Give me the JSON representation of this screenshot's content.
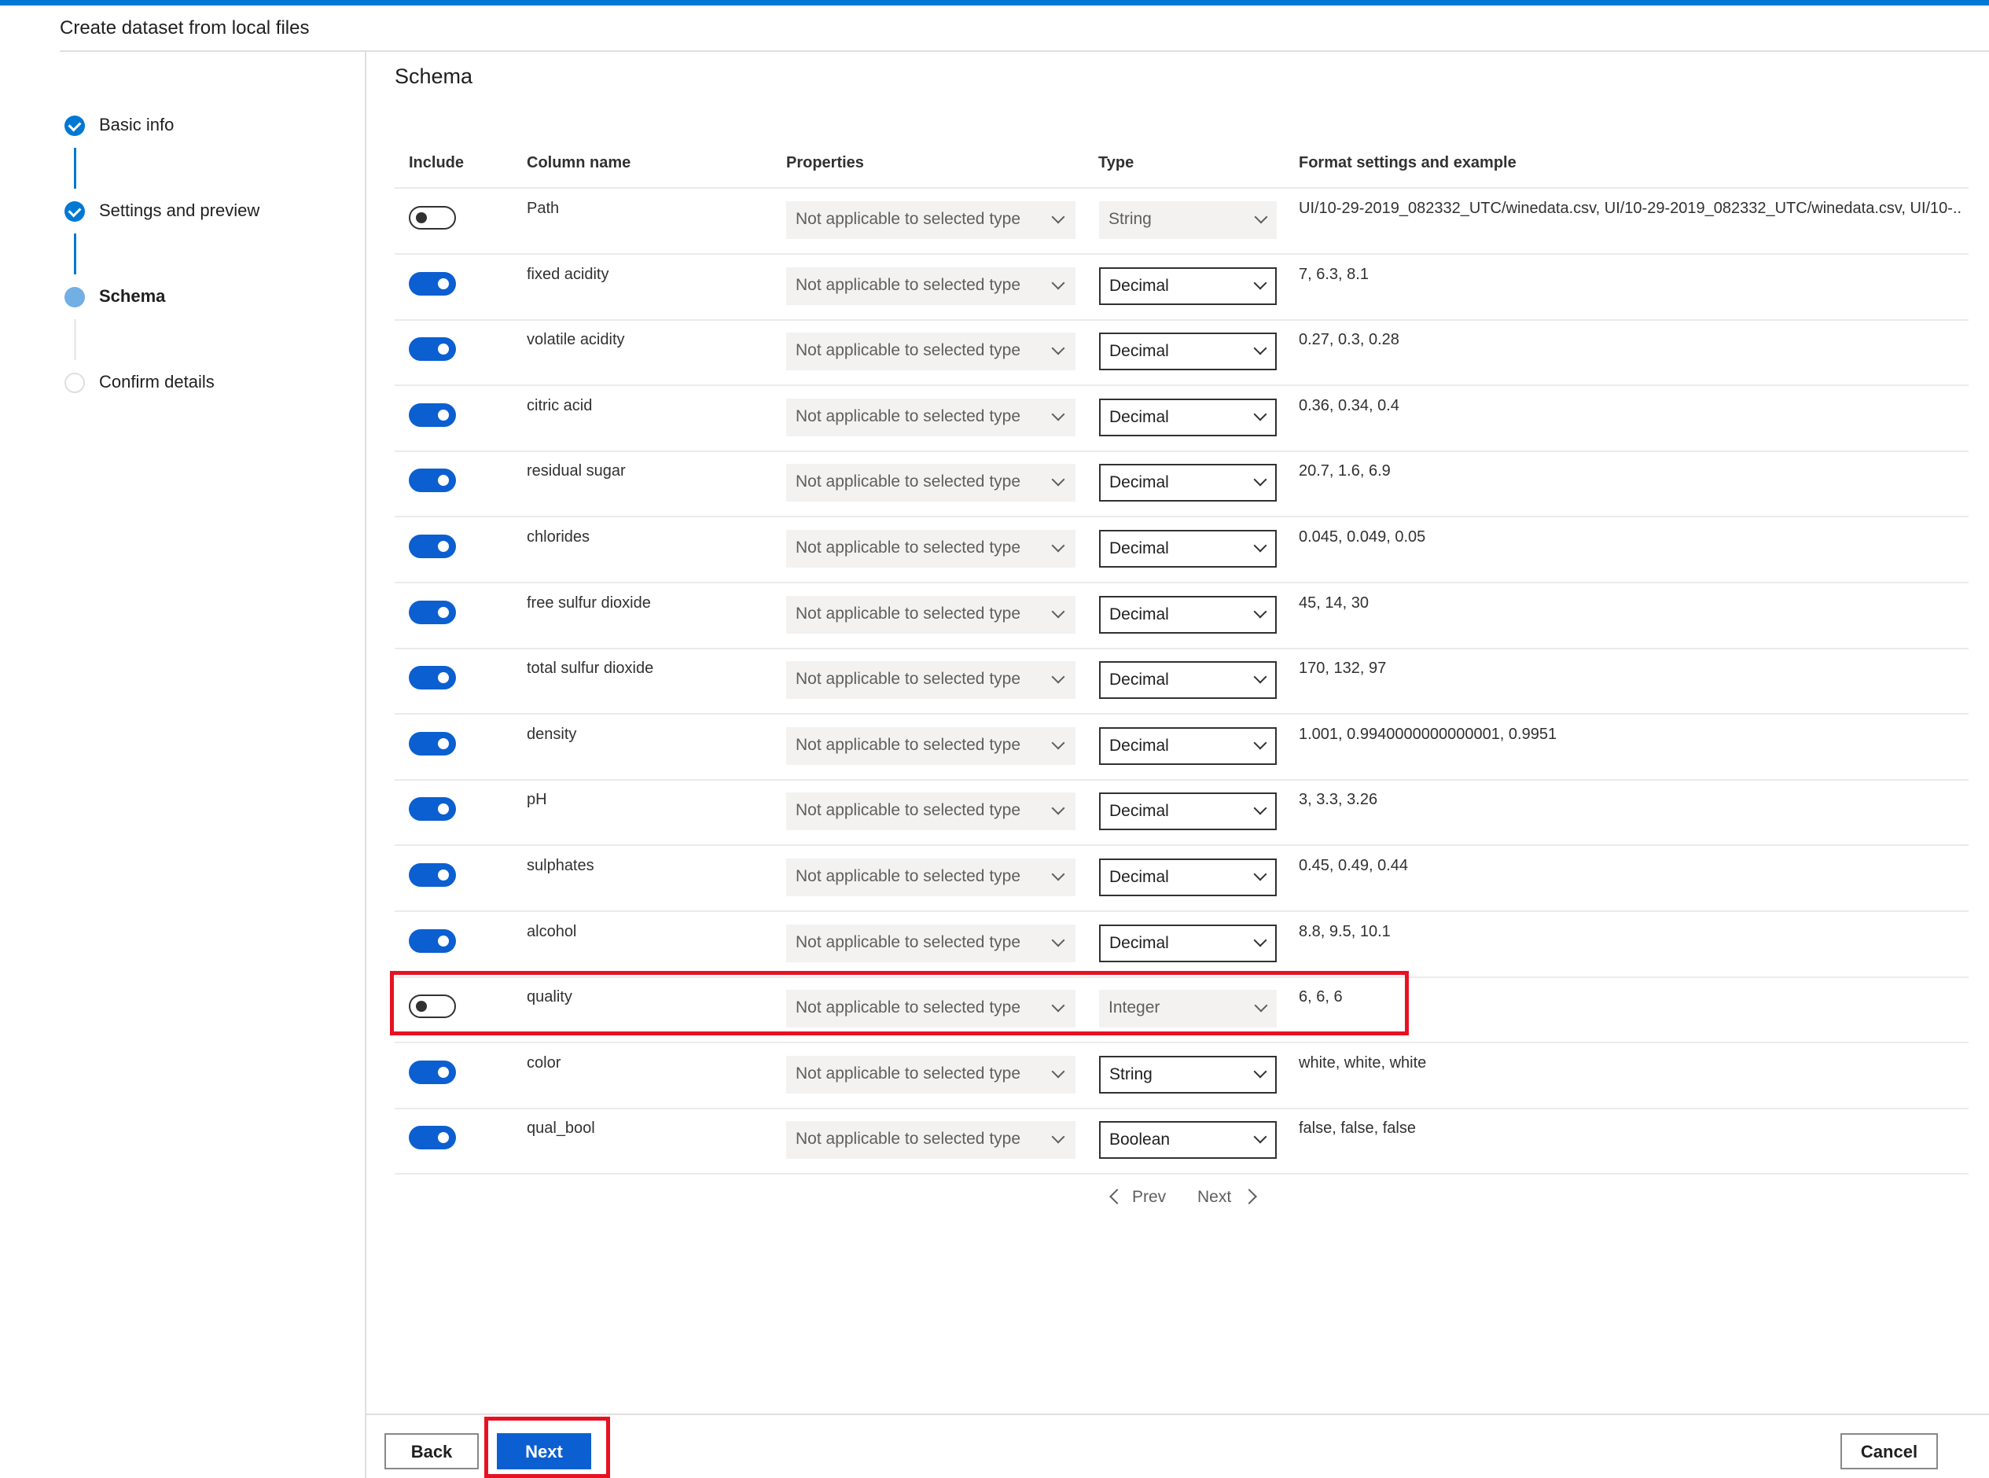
{
  "header": {
    "title": "Create dataset from local files"
  },
  "steps": [
    {
      "label": "Basic info",
      "state": "done"
    },
    {
      "label": "Settings and preview",
      "state": "done"
    },
    {
      "label": "Schema",
      "state": "current"
    },
    {
      "label": "Confirm details",
      "state": "pending"
    }
  ],
  "main": {
    "section_title": "Schema",
    "columns": {
      "include": "Include",
      "column_name": "Column name",
      "properties": "Properties",
      "type": "Type",
      "format": "Format settings and example"
    },
    "rows": [
      {
        "include": false,
        "name": "Path",
        "properties": "Not applicable to selected type",
        "type": "String",
        "type_enabled": false,
        "example": "UI/10-29-2019_082332_UTC/winedata.csv, UI/10-29-2019_082332_UTC/winedata.csv, UI/10-..."
      },
      {
        "include": true,
        "name": "fixed acidity",
        "properties": "Not applicable to selected type",
        "type": "Decimal",
        "type_enabled": true,
        "example": "7, 6.3, 8.1"
      },
      {
        "include": true,
        "name": "volatile acidity",
        "properties": "Not applicable to selected type",
        "type": "Decimal",
        "type_enabled": true,
        "example": "0.27, 0.3, 0.28"
      },
      {
        "include": true,
        "name": "citric acid",
        "properties": "Not applicable to selected type",
        "type": "Decimal",
        "type_enabled": true,
        "example": "0.36, 0.34, 0.4"
      },
      {
        "include": true,
        "name": "residual sugar",
        "properties": "Not applicable to selected type",
        "type": "Decimal",
        "type_enabled": true,
        "example": "20.7, 1.6, 6.9"
      },
      {
        "include": true,
        "name": "chlorides",
        "properties": "Not applicable to selected type",
        "type": "Decimal",
        "type_enabled": true,
        "example": "0.045, 0.049, 0.05"
      },
      {
        "include": true,
        "name": "free sulfur dioxide",
        "properties": "Not applicable to selected type",
        "type": "Decimal",
        "type_enabled": true,
        "example": "45, 14, 30"
      },
      {
        "include": true,
        "name": "total sulfur dioxide",
        "properties": "Not applicable to selected type",
        "type": "Decimal",
        "type_enabled": true,
        "example": "170, 132, 97"
      },
      {
        "include": true,
        "name": "density",
        "properties": "Not applicable to selected type",
        "type": "Decimal",
        "type_enabled": true,
        "example": "1.001, 0.9940000000000001, 0.9951"
      },
      {
        "include": true,
        "name": "pH",
        "properties": "Not applicable to selected type",
        "type": "Decimal",
        "type_enabled": true,
        "example": "3, 3.3, 3.26"
      },
      {
        "include": true,
        "name": "sulphates",
        "properties": "Not applicable to selected type",
        "type": "Decimal",
        "type_enabled": true,
        "example": "0.45, 0.49, 0.44"
      },
      {
        "include": true,
        "name": "alcohol",
        "properties": "Not applicable to selected type",
        "type": "Decimal",
        "type_enabled": true,
        "example": "8.8, 9.5, 10.1"
      },
      {
        "include": false,
        "name": "quality",
        "properties": "Not applicable to selected type",
        "type": "Integer",
        "type_enabled": false,
        "example": "6, 6, 6"
      },
      {
        "include": true,
        "name": "color",
        "properties": "Not applicable to selected type",
        "type": "String",
        "type_enabled": true,
        "example": "white, white, white"
      },
      {
        "include": true,
        "name": "qual_bool",
        "properties": "Not applicable to selected type",
        "type": "Boolean",
        "type_enabled": true,
        "example": "false, false, false"
      }
    ],
    "pager": {
      "prev": "Prev",
      "next": "Next"
    }
  },
  "footer": {
    "back": "Back",
    "next": "Next",
    "cancel": "Cancel"
  },
  "colors": {
    "accent": "#0078d4",
    "toggle_on": "#0b5fd0",
    "highlight": "#e81123"
  }
}
